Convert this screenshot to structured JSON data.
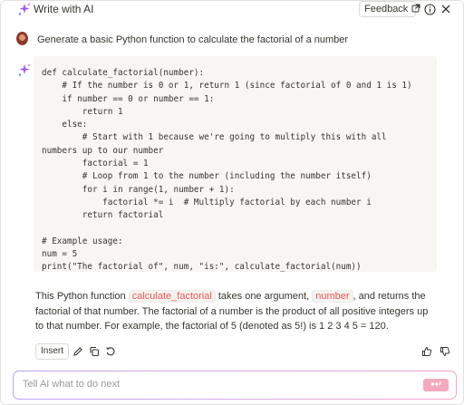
{
  "header": {
    "title": "Write with AI",
    "feedback_label": "Feedback",
    "icons": [
      "sparkle-icon",
      "external-link-icon",
      "info-icon",
      "close-icon"
    ]
  },
  "prompt": {
    "text": "Generate a basic Python function to calculate the factorial of a number"
  },
  "response": {
    "code": "def calculate_factorial(number):\n    # If the number is 0 or 1, return 1 (since factorial of 0 and 1 is 1)\n    if number == 0 or number == 1:\n        return 1\n    else:\n        # Start with 1 because we're going to multiply this with all\nnumbers up to our number\n        factorial = 1\n        # Loop from 1 to the number (including the number itself)\n        for i in range(1, number + 1):\n            factorial *= i  # Multiply factorial by each number i\n        return factorial\n\n# Example usage:\nnum = 5\nprint(\"The factorial of\", num, \"is:\", calculate_factorial(num))",
    "explanation": {
      "part1": "This Python function ",
      "code1": "calculate_factorial",
      "part2": " takes one argument, ",
      "code2": "number",
      "part3": ", and returns the factorial of that number. The factorial of a number is the product of all positive integers up to that number. For example, the factorial of 5 (denoted as 5!) is 1  2  3  4  5 = 120."
    }
  },
  "actions": {
    "insert_label": "Insert",
    "icons": [
      "edit-icon",
      "copy-icon",
      "retry-icon",
      "thumbs-up-icon",
      "thumbs-down-icon"
    ]
  },
  "input": {
    "placeholder": "Tell AI what to do next",
    "value": ""
  },
  "colors": {
    "accent_pink": "#f5a9bf",
    "inline_code_red": "#eb5757",
    "code_bg": "#f7f6f3"
  }
}
